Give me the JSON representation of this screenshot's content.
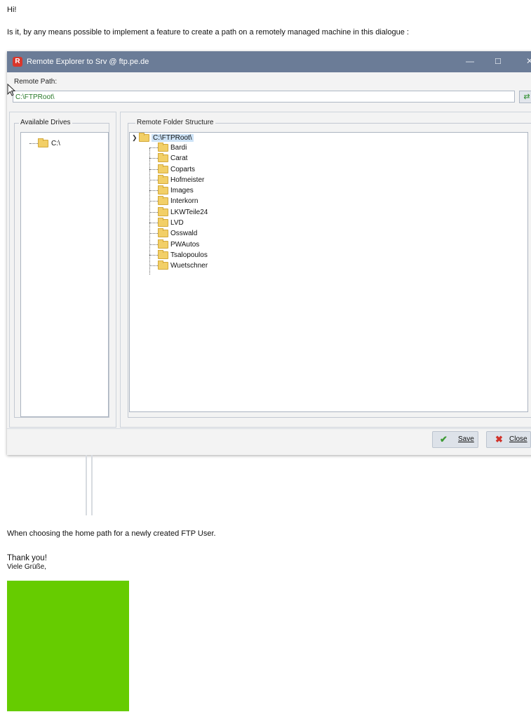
{
  "email": {
    "greeting": "Hi!",
    "question": "Is it, by any means possible to implement  a feature to create a path on a remotely managed machine in this dialogue :",
    "after_text": "When choosing the home path for a newly created FTP User.",
    "thanks": "Thank you!",
    "regards": "Viele Grüße,"
  },
  "dialog": {
    "title": "Remote Explorer to Srv @ ftp.pe.de",
    "app_icon_letter": "R",
    "remote_path_label": "Remote Path:",
    "remote_path_value": "C:\\FTPRoot\\",
    "drives_group_title": "Available Drives",
    "drives": [
      "C:\\"
    ],
    "tree_group_title": "Remote Folder Structure",
    "tree_root": "C:\\FTPRoot\\",
    "folders": [
      "Bardi",
      "Carat",
      "Coparts",
      "Hofmeister",
      "Images",
      "Interkorn",
      "LKWTeile24",
      "LVD",
      "Osswald",
      "PWAutos",
      "Tsalopoulos",
      "Wuetschner"
    ],
    "save_label": "Save",
    "close_label": "Close"
  },
  "colors": {
    "titlebar": "#6b7c97",
    "signature_block": "#66cc00",
    "path_text": "#2a7a2a"
  },
  "icons": [
    "app-r-icon",
    "minimize-icon",
    "maximize-icon",
    "close-icon",
    "go-path-icon",
    "drive-icon",
    "folder-icon",
    "checkmark-icon",
    "x-icon",
    "mouse-cursor-icon"
  ]
}
